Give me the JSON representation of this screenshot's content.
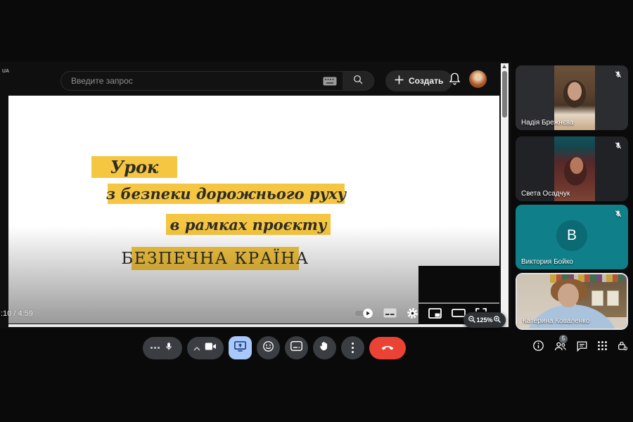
{
  "browser": {
    "region_label": "UA",
    "search_placeholder": "Введите запрос",
    "create_label": "Создать"
  },
  "video": {
    "slide_lines": [
      "Урок",
      "з безпеки дорожнього руху",
      "в рамках проєкту",
      "БЕЗПЕЧНА КРАЇНА"
    ],
    "time_display": ":10 / 4:59"
  },
  "presentation_zoom": "125%",
  "participants": [
    {
      "name": "Надія Брежнєва",
      "muted": true
    },
    {
      "name": "Света Осадчук",
      "muted": true
    },
    {
      "name": "Виктория Бойко",
      "muted": true,
      "initial": "В"
    },
    {
      "name": "Катерина Коваленко",
      "muted": false
    }
  ],
  "meet": {
    "people_count": "5"
  },
  "colors": {
    "present_active": "#a8c7fa",
    "hangup_red": "#ea4335",
    "slide_highlight": "#f5c641",
    "tile_teal": "#0f7f89"
  }
}
